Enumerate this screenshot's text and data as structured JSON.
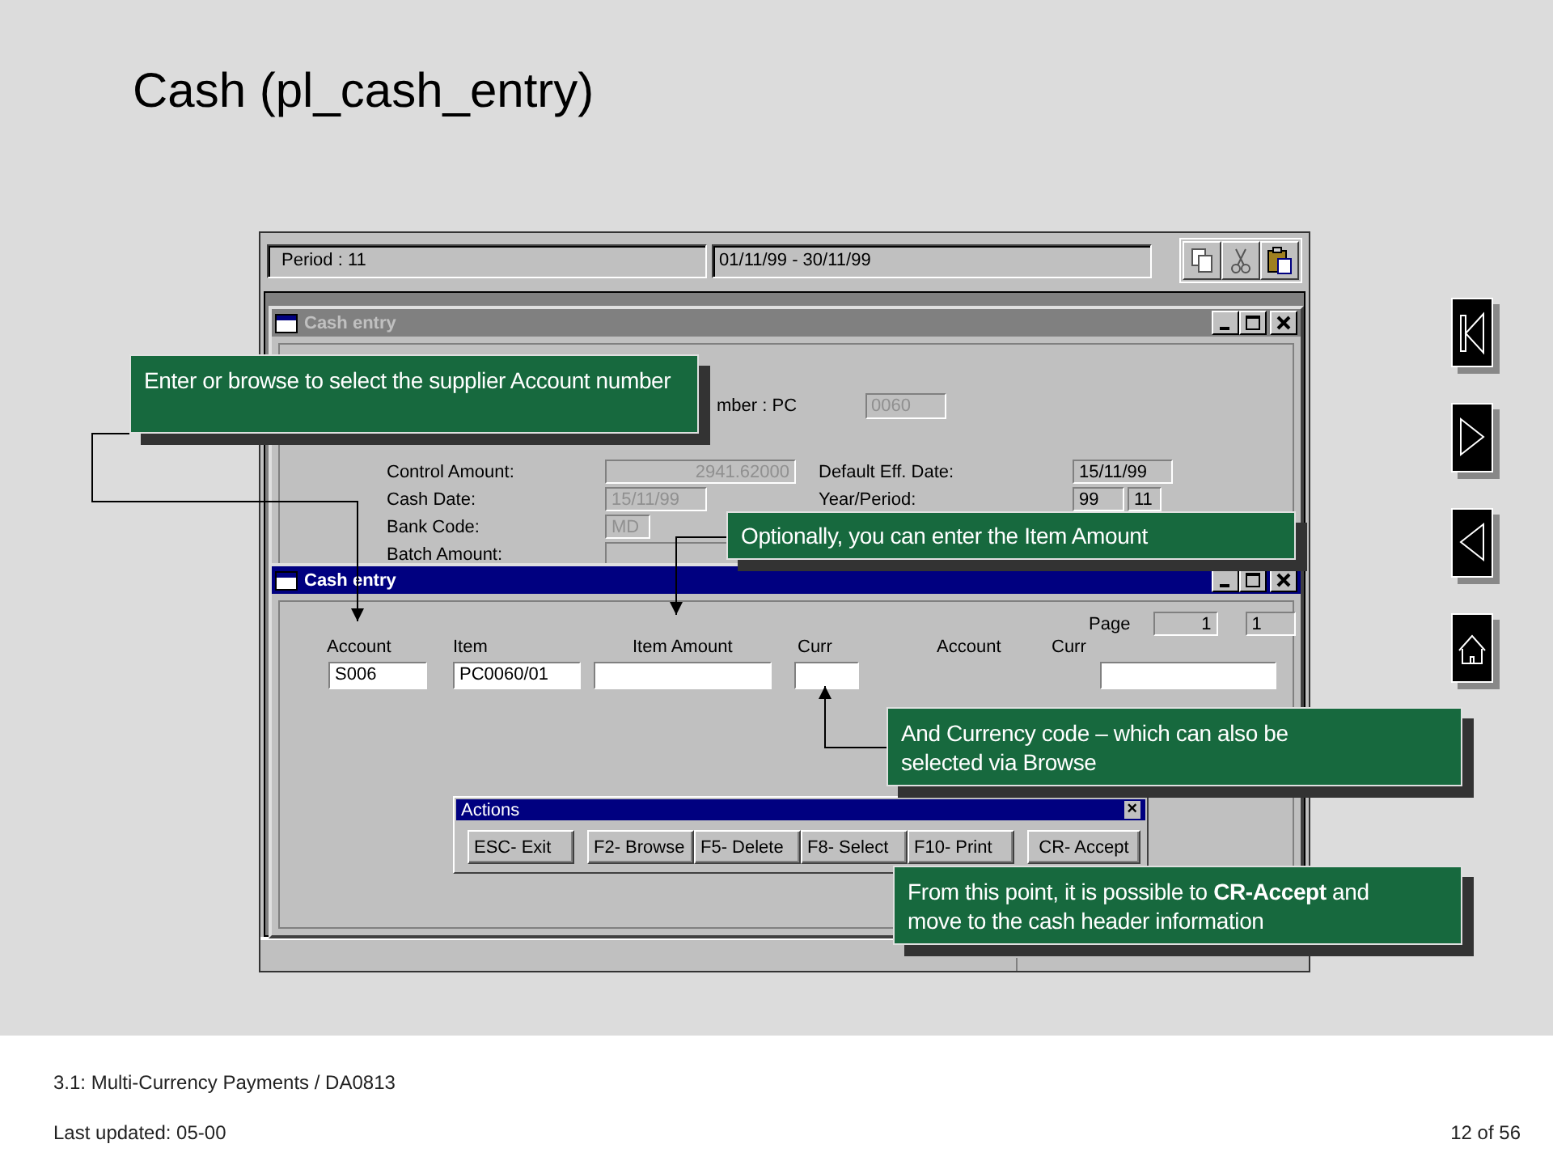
{
  "slide_title": "Cash (pl_cash_entry)",
  "app": {
    "period_field": "Period : 11",
    "date_range_field": "01/11/99 - 30/11/99",
    "header_window": {
      "title": "Cash entry",
      "active": false,
      "number_label": "mber : PC",
      "number_field": {
        "value": "0060",
        "disabled": true
      },
      "left_fields": [
        {
          "label": "Control Amount:",
          "values": [
            "2941.62000"
          ],
          "disabled": true
        },
        {
          "label": "Cash Date:",
          "values": [
            "15/11/99"
          ],
          "disabled": true
        },
        {
          "label": "Bank Code:",
          "values": [
            "MD"
          ],
          "disabled": true
        },
        {
          "label": "Batch Amount:"
        }
      ],
      "right_fields": [
        {
          "label": "Default Eff. Date:",
          "values": [
            "15/11/99"
          ],
          "disabled": false
        },
        {
          "label": "Year/Period:",
          "values": [
            "99",
            "11"
          ],
          "disabled": false
        }
      ]
    },
    "line_window": {
      "title": "Cash entry",
      "active": true,
      "page_label": "Page",
      "page_values": [
        "1",
        "1"
      ],
      "columns": [
        "Account",
        "Item",
        "Item Amount",
        "Curr",
        "Account",
        "Curr"
      ],
      "inputs": [
        {
          "kind": "input",
          "value": "S006"
        },
        {
          "kind": "input",
          "value": "PC0060/01"
        },
        {
          "kind": "input"
        },
        {
          "kind": "input"
        },
        {
          "kind": "input"
        }
      ]
    },
    "actions": {
      "title": "Actions",
      "close": "×",
      "buttons": [
        "ESC- Exit",
        "F2- Browse",
        "F5- Delete",
        "F8- Select",
        "F10- Print",
        "CR- Accept"
      ]
    }
  },
  "callouts": [
    {
      "text": "Enter or browse to select the supplier Account number"
    },
    {
      "text": "Optionally, you can enter the Item Amount"
    },
    {
      "text": "And Currency code – which can also be selected via Browse"
    },
    {
      "text": "From this point, it is possible to **CR-Accept** and move to the cash header information"
    }
  ],
  "footer": {
    "course": "3.1: Multi-Currency  Payments / DA0813",
    "updated": "Last updated:  05-00",
    "page": "12 of 56"
  }
}
